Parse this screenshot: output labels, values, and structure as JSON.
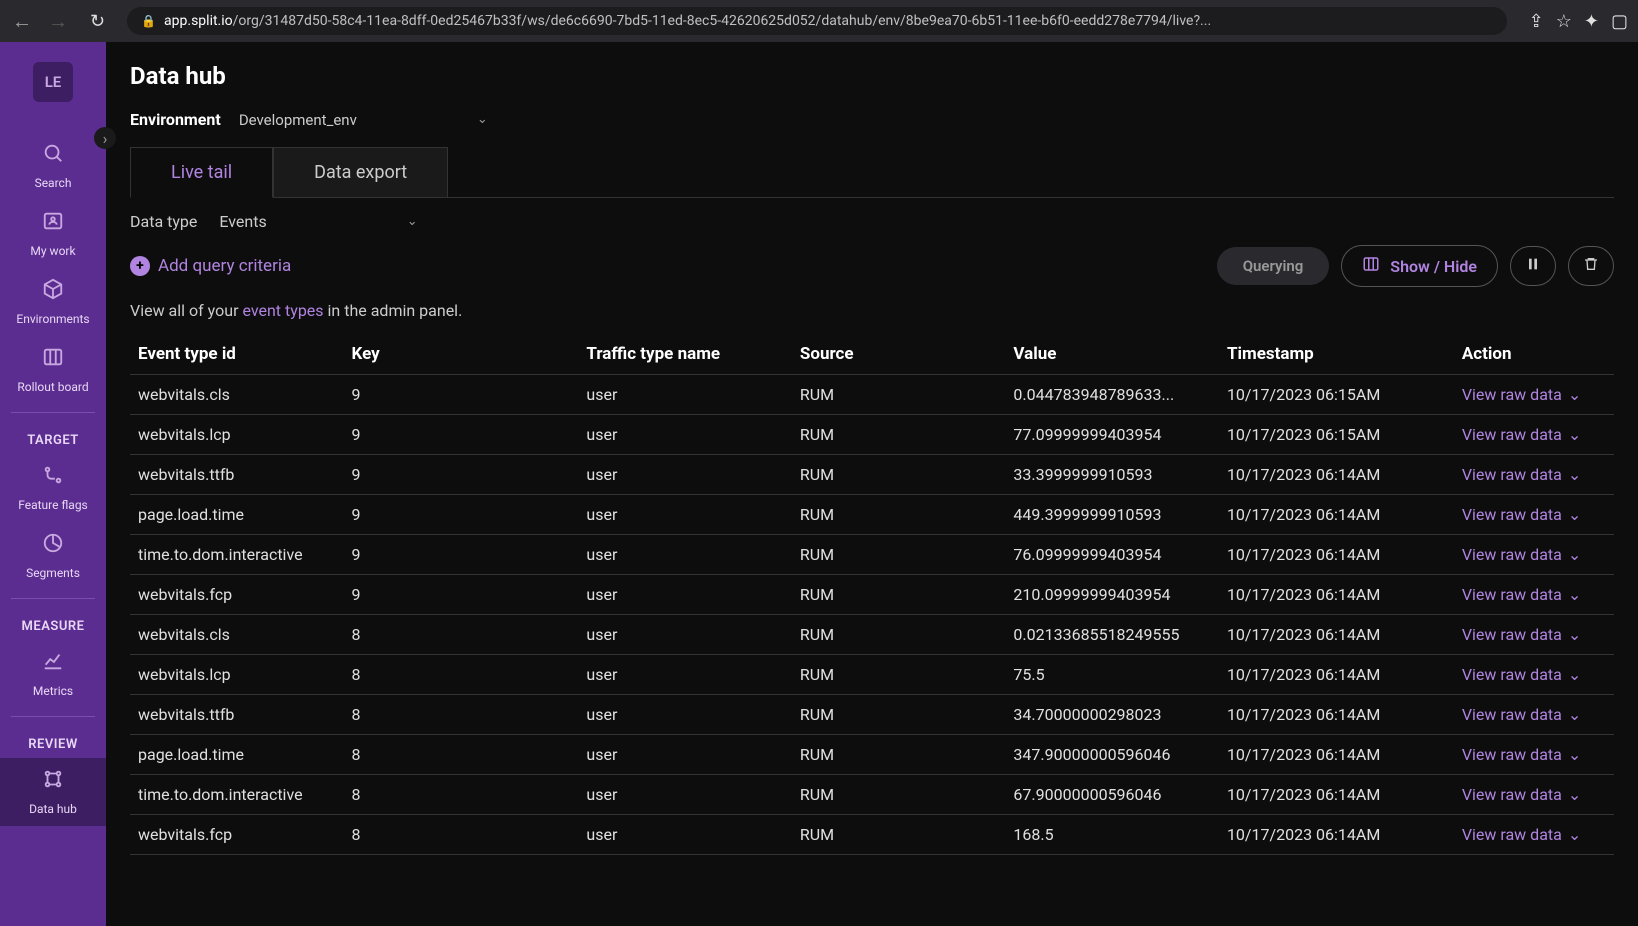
{
  "browser": {
    "url_domain": "app.split.io",
    "url_path": "/org/31487d50-58c4-11ea-8dff-0ed25467b33f/ws/de6c6690-7bd5-11ed-8ec5-42620625d052/datahub/env/8be9ea70-6b51-11ee-b6f0-eedd278e7794/live?..."
  },
  "sidebar": {
    "logo": "LE",
    "sections": {
      "main": [
        {
          "label": "Search"
        },
        {
          "label": "My work"
        },
        {
          "label": "Environments"
        },
        {
          "label": "Rollout board"
        }
      ],
      "target_label": "TARGET",
      "target": [
        {
          "label": "Feature flags"
        },
        {
          "label": "Segments"
        }
      ],
      "measure_label": "MEASURE",
      "measure": [
        {
          "label": "Metrics"
        }
      ],
      "review_label": "REVIEW",
      "review": [
        {
          "label": "Data hub"
        }
      ]
    }
  },
  "page": {
    "title": "Data hub",
    "env_label": "Environment",
    "env_value": "Development_env",
    "tabs": {
      "live_tail": "Live tail",
      "data_export": "Data export"
    },
    "datatype_label": "Data type",
    "datatype_value": "Events",
    "add_criteria": "Add query criteria",
    "querying": "Querying",
    "show_hide": "Show / Hide",
    "hint_prefix": "View all of your ",
    "hint_link": "event types",
    "hint_suffix": " in the admin panel."
  },
  "table": {
    "headers": {
      "event_type": "Event type id",
      "key": "Key",
      "traffic": "Traffic type name",
      "source": "Source",
      "value": "Value",
      "timestamp": "Timestamp",
      "action": "Action"
    },
    "action_label": "View raw data",
    "rows": [
      {
        "event": "webvitals.cls",
        "key": "9",
        "traffic": "user",
        "source": "RUM",
        "value": "0.044783948789633...",
        "timestamp": "10/17/2023 06:15AM"
      },
      {
        "event": "webvitals.lcp",
        "key": "9",
        "traffic": "user",
        "source": "RUM",
        "value": "77.09999999403954",
        "timestamp": "10/17/2023 06:15AM"
      },
      {
        "event": "webvitals.ttfb",
        "key": "9",
        "traffic": "user",
        "source": "RUM",
        "value": "33.3999999910593",
        "timestamp": "10/17/2023 06:14AM"
      },
      {
        "event": "page.load.time",
        "key": "9",
        "traffic": "user",
        "source": "RUM",
        "value": "449.3999999910593",
        "timestamp": "10/17/2023 06:14AM"
      },
      {
        "event": "time.to.dom.interactive",
        "key": "9",
        "traffic": "user",
        "source": "RUM",
        "value": "76.09999999403954",
        "timestamp": "10/17/2023 06:14AM"
      },
      {
        "event": "webvitals.fcp",
        "key": "9",
        "traffic": "user",
        "source": "RUM",
        "value": "210.09999999403954",
        "timestamp": "10/17/2023 06:14AM"
      },
      {
        "event": "webvitals.cls",
        "key": "8",
        "traffic": "user",
        "source": "RUM",
        "value": "0.02133685518249555",
        "timestamp": "10/17/2023 06:14AM"
      },
      {
        "event": "webvitals.lcp",
        "key": "8",
        "traffic": "user",
        "source": "RUM",
        "value": "75.5",
        "timestamp": "10/17/2023 06:14AM"
      },
      {
        "event": "webvitals.ttfb",
        "key": "8",
        "traffic": "user",
        "source": "RUM",
        "value": "34.70000000298023",
        "timestamp": "10/17/2023 06:14AM"
      },
      {
        "event": "page.load.time",
        "key": "8",
        "traffic": "user",
        "source": "RUM",
        "value": "347.90000000596046",
        "timestamp": "10/17/2023 06:14AM"
      },
      {
        "event": "time.to.dom.interactive",
        "key": "8",
        "traffic": "user",
        "source": "RUM",
        "value": "67.90000000596046",
        "timestamp": "10/17/2023 06:14AM"
      },
      {
        "event": "webvitals.fcp",
        "key": "8",
        "traffic": "user",
        "source": "RUM",
        "value": "168.5",
        "timestamp": "10/17/2023 06:14AM"
      }
    ]
  }
}
